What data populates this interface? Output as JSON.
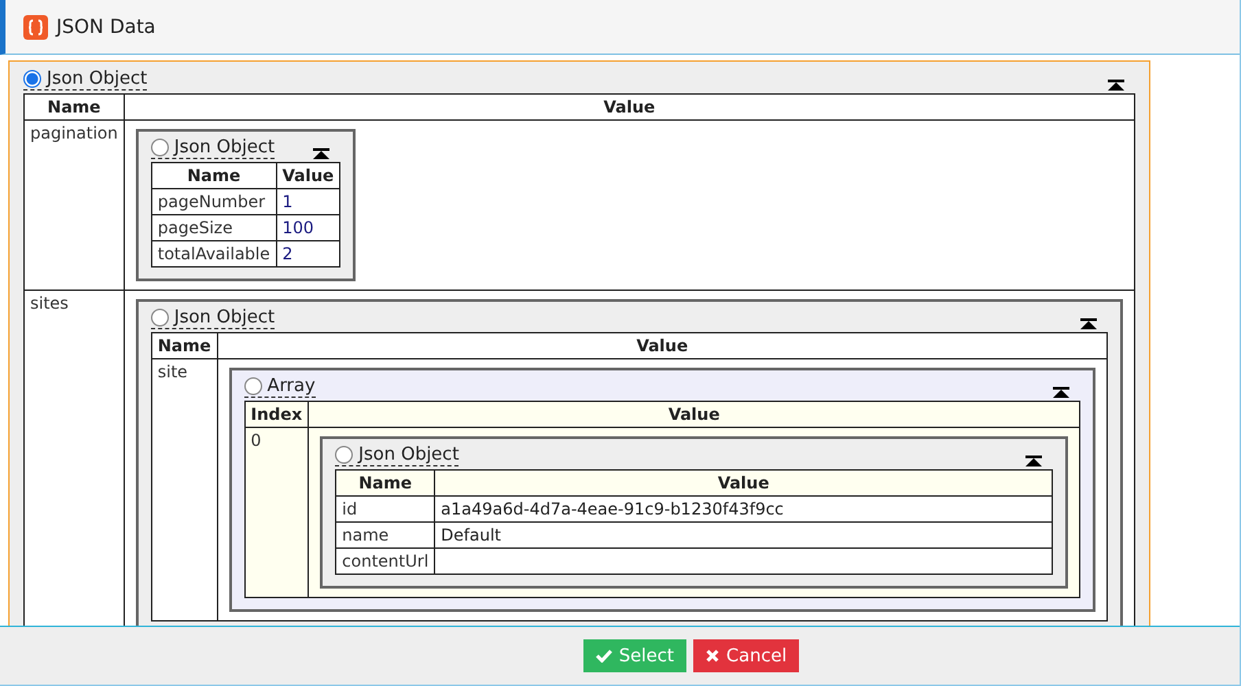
{
  "window": {
    "title": "JSON Data"
  },
  "root": {
    "kind": "object",
    "label": "Json Object",
    "selected": true,
    "columns": [
      "Name",
      "Value"
    ],
    "rows": [
      {
        "name": "pagination",
        "value": {
          "kind": "object",
          "label": "Json Object",
          "selected": false,
          "columns": [
            "Name",
            "Value"
          ],
          "rows": [
            {
              "name": "pageNumber",
              "value": "1"
            },
            {
              "name": "pageSize",
              "value": "100"
            },
            {
              "name": "totalAvailable",
              "value": "2"
            }
          ]
        }
      },
      {
        "name": "sites",
        "value": {
          "kind": "object",
          "label": "Json Object",
          "selected": false,
          "columns": [
            "Name",
            "Value"
          ],
          "rows": [
            {
              "name": "site",
              "value": {
                "kind": "array",
                "label": "Array",
                "selected": false,
                "columns": [
                  "Index",
                  "Value"
                ],
                "rows": [
                  {
                    "name": "0",
                    "value": {
                      "kind": "object",
                      "label": "Json Object",
                      "selected": false,
                      "columns": [
                        "Name",
                        "Value"
                      ],
                      "rows": [
                        {
                          "name": "id",
                          "value": "a1a49a6d-4d7a-4eae-91c9-b1230f43f9cc"
                        },
                        {
                          "name": "name",
                          "value": "Default"
                        },
                        {
                          "name": "contentUrl"
                        }
                      ]
                    }
                  }
                ]
              }
            }
          ]
        }
      }
    ]
  },
  "buttons": [
    {
      "kind": "confirm",
      "label": "Select"
    },
    {
      "kind": "cancel",
      "label": "Cancel"
    }
  ]
}
